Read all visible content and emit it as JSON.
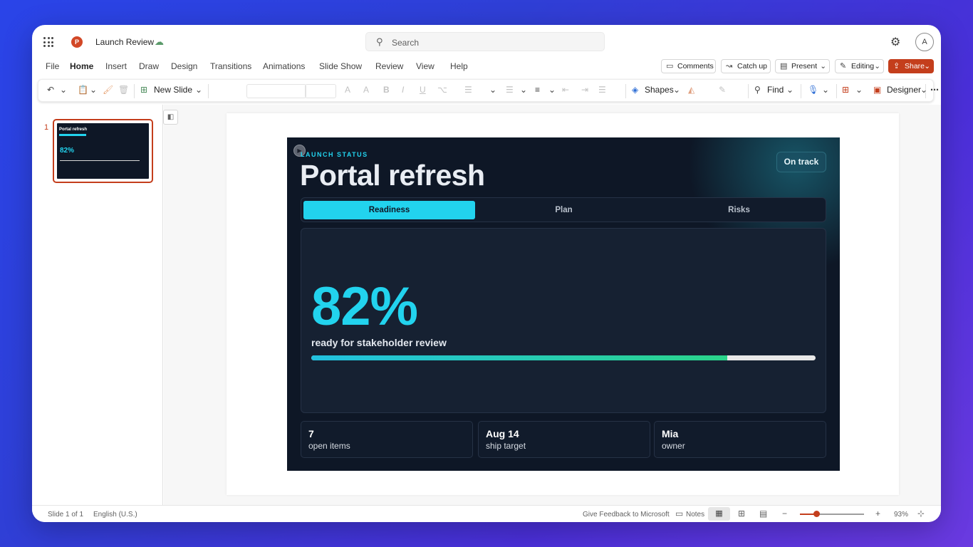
{
  "app": {
    "doc_title": "Launch Review",
    "search_placeholder": "Search",
    "avatar_initial": "A",
    "logo_letter": "P"
  },
  "menu": {
    "tabs": [
      "File",
      "Home",
      "Insert",
      "Draw",
      "Design",
      "Transitions",
      "Animations",
      "Slide Show",
      "Review",
      "View",
      "Help"
    ],
    "active": "Home",
    "comments_label": "Comments",
    "catchup_label": "Catch up",
    "present_label": "Present",
    "editing_label": "Editing",
    "share_label": "Share"
  },
  "ribbon": {
    "new_slide_label": "New Slide",
    "shapes_label": "Shapes",
    "find_label": "Find",
    "designer_label": "Designer"
  },
  "thumbnails": [
    {
      "number": "1",
      "title": "Portal refresh",
      "percent": "82%"
    }
  ],
  "slide": {
    "kicker": "LAUNCH STATUS",
    "title": "Portal refresh",
    "status_badge": "On track",
    "tabs": [
      "Readiness",
      "Plan",
      "Risks"
    ],
    "active_tab": "Readiness",
    "percent_text": "82%",
    "percent_label": "ready for stakeholder review",
    "progress": 0.825,
    "stats": [
      {
        "value": "7",
        "label": "open items"
      },
      {
        "value": "Aug 14",
        "label": "ship target"
      },
      {
        "value": "Mia",
        "label": "owner"
      }
    ]
  },
  "statusbar": {
    "slide_position": "Slide 1 of 1",
    "language": "English (U.S.)",
    "feedback": "Give Feedback to Microsoft",
    "notes": "Notes",
    "zoom": "93%",
    "zoom_fraction": 0.26
  },
  "colors": {
    "accent": "#c43e1c",
    "slide_bg": "#0e1726",
    "cyan": "#22d3ee",
    "green": "#2bd48a"
  }
}
